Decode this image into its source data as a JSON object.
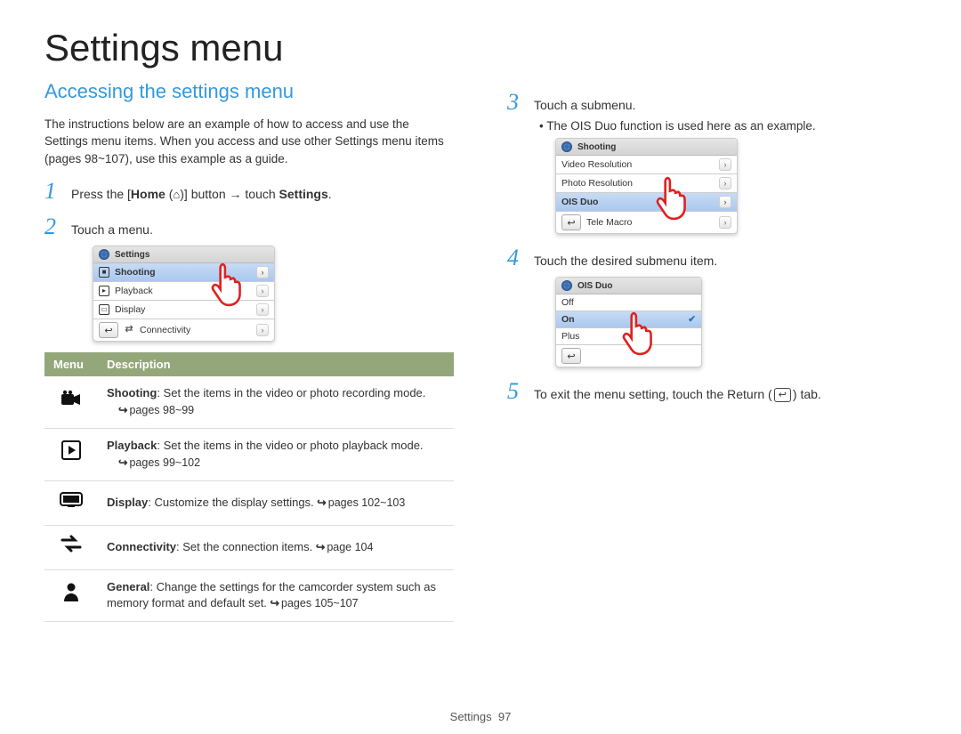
{
  "title": "Settings menu",
  "section_title": "Accessing the settings menu",
  "intro": "The instructions below are an example of how to access and use the Settings menu items. When you access and use other Settings menu items (pages 98~107), use this example as a guide.",
  "steps": {
    "s1_pre": "Press the [",
    "s1_home": "Home",
    "s1_post": "] button → touch ",
    "s1_settings": "Settings",
    "s1_end": ".",
    "s2": "Touch a menu.",
    "s3": "Touch a submenu.",
    "s3_note": "The OIS Duo function is used here as an example.",
    "s4": "Touch the desired submenu item.",
    "s5_pre": "To exit the menu setting, touch the Return (",
    "s5_post": ") tab."
  },
  "device1": {
    "header": "Settings",
    "rows": [
      "Shooting",
      "Playback",
      "Display",
      "Connectivity"
    ]
  },
  "device2": {
    "header": "Shooting",
    "rows": [
      "Video Resolution",
      "Photo Resolution",
      "OIS Duo",
      "Tele Macro"
    ]
  },
  "device3": {
    "header": "OIS Duo",
    "rows": [
      "Off",
      "On",
      "Plus"
    ]
  },
  "table": {
    "col1": "Menu",
    "col2": "Description",
    "rows": [
      {
        "name": "Shooting",
        "text": ": Set the items in the video or photo recording mode.",
        "pages": "pages 98~99"
      },
      {
        "name": "Playback",
        "text": ": Set the items in the video or photo playback mode.",
        "pages": "pages 99~102"
      },
      {
        "name": "Display",
        "text": ": Customize the display settings. ",
        "pages": "pages 102~103"
      },
      {
        "name": "Connectivity",
        "text": ": Set the connection items. ",
        "pages": "page 104"
      },
      {
        "name": "General",
        "text": ": Change the settings for the camcorder system such as memory format and default set. ",
        "pages": "pages 105~107"
      }
    ]
  },
  "footer": {
    "label": "Settings",
    "page": "97"
  }
}
